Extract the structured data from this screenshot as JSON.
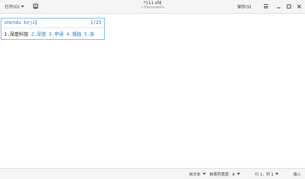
{
  "header": {
    "open_label": "打开(O)",
    "doc_title": "*111.sfd",
    "doc_subtitle": "~/Documents",
    "save_label": "保存(S)"
  },
  "ime": {
    "preedit": "shendu keji",
    "page_indicator": "1/25",
    "candidates": [
      {
        "label": "1.深度科技",
        "selected": true
      },
      {
        "label": "2.深度",
        "selected": false
      },
      {
        "label": "3.申读",
        "selected": false
      },
      {
        "label": "4.慎独",
        "selected": false
      },
      {
        "label": "5.身",
        "selected": false
      }
    ]
  },
  "statusbar": {
    "language": "纯文本",
    "tab_width": "制表符宽度：8",
    "cursor_position": "行 1，列 1",
    "insert_mode": "插入"
  },
  "colors": {
    "ime_accent": "#2f7ad6",
    "ime_border": "#7db3ef",
    "headerbar_bg": "#f6f5f4"
  },
  "icons": {
    "new_document": "new-document-icon",
    "menu": "hamburger-menu-icon",
    "minimize": "minimize-icon",
    "maximize": "maximize-icon",
    "close": "close-icon"
  }
}
